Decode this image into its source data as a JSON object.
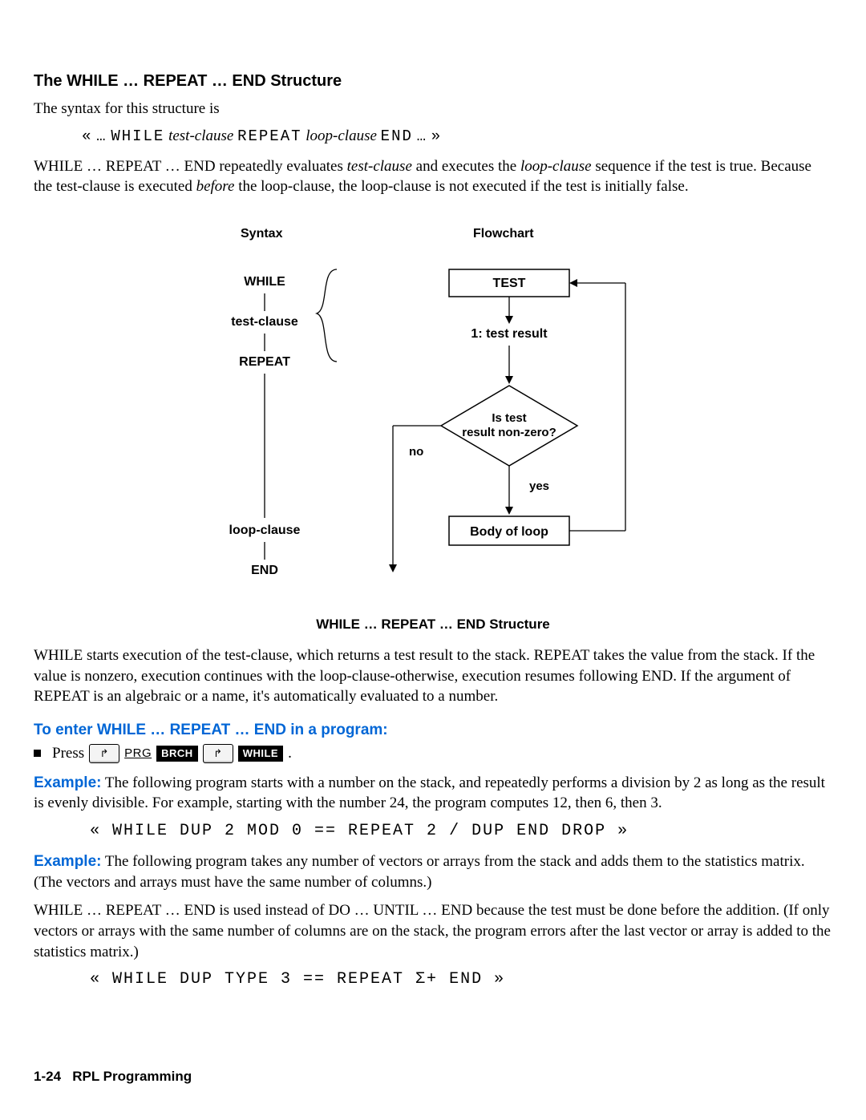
{
  "heading": "The WHILE … REPEAT … END Structure",
  "intro": "The syntax for this structure is",
  "syntax": {
    "open": "«",
    "dots1": "…",
    "while": "WHILE",
    "test": "test-clause",
    "repeat": "REPEAT",
    "loop": "loop-clause",
    "end": "END",
    "dots2": "…",
    "close": "»"
  },
  "para_desc_pre": "WHILE … REPEAT … END repeatedly evaluates ",
  "para_desc_test": "test-clause",
  "para_desc_mid": " and executes the ",
  "para_desc_loop": "loop-clause",
  "para_desc_post": " sequence if the test is true. Because the test-clause is executed ",
  "para_desc_before": "before",
  "para_desc_tail": " the loop-clause, the loop-clause is not executed if the test is initially false.",
  "fig": {
    "col_syntax": "Syntax",
    "col_flow": "Flowchart",
    "while": "WHILE",
    "test_clause": "test-clause",
    "repeat": "REPEAT",
    "loop_clause": "loop-clause",
    "end": "END",
    "box_test": "TEST",
    "label_result": "1: test result",
    "diamond_l1": "Is test",
    "diamond_l2": "result non-zero?",
    "no": "no",
    "yes": "yes",
    "body": "Body of loop",
    "caption": "WHILE … REPEAT … END Structure"
  },
  "para_starts": "WHILE starts execution of the test-clause, which returns a test result to the stack. REPEAT takes the value from the stack. If the value is nonzero, execution continues with the loop-clause-otherwise, execution resumes following END. If the argument of REPEAT is an algebraic or a name, it's automatically evaluated to a number.",
  "bluehead": "To enter WHILE … REPEAT … END in a program:",
  "press": {
    "word": "Press",
    "prg": "PRG",
    "brch": "BRCH",
    "while": "WHILE",
    "period": "."
  },
  "example1": {
    "label": "Example:",
    "text": " The following program starts with a number on the stack, and repeatedly performs a division by 2 as long as the result is evenly divisible. For example, starting with the number 24, the program computes 12, then 6, then 3.",
    "code": "« WHILE DUP 2 MOD 0 == REPEAT 2 / DUP END DROP »"
  },
  "example2": {
    "label": "Example:",
    "text": "  The following program takes any number of vectors or arrays from the stack and adds them to the statistics matrix. (The vectors and arrays must have the same number of columns.)"
  },
  "para_why": "WHILE … REPEAT … END is used instead of DO … UNTIL … END because the test must be done before the addition. (If only vectors or arrays with the same number of columns are on the stack, the program errors after the last vector or array is added to the statistics matrix.)",
  "code2": "« WHILE DUP TYPE 3 == REPEAT Σ+ END »",
  "footer": {
    "page": "1-24",
    "title": "RPL Programming"
  }
}
